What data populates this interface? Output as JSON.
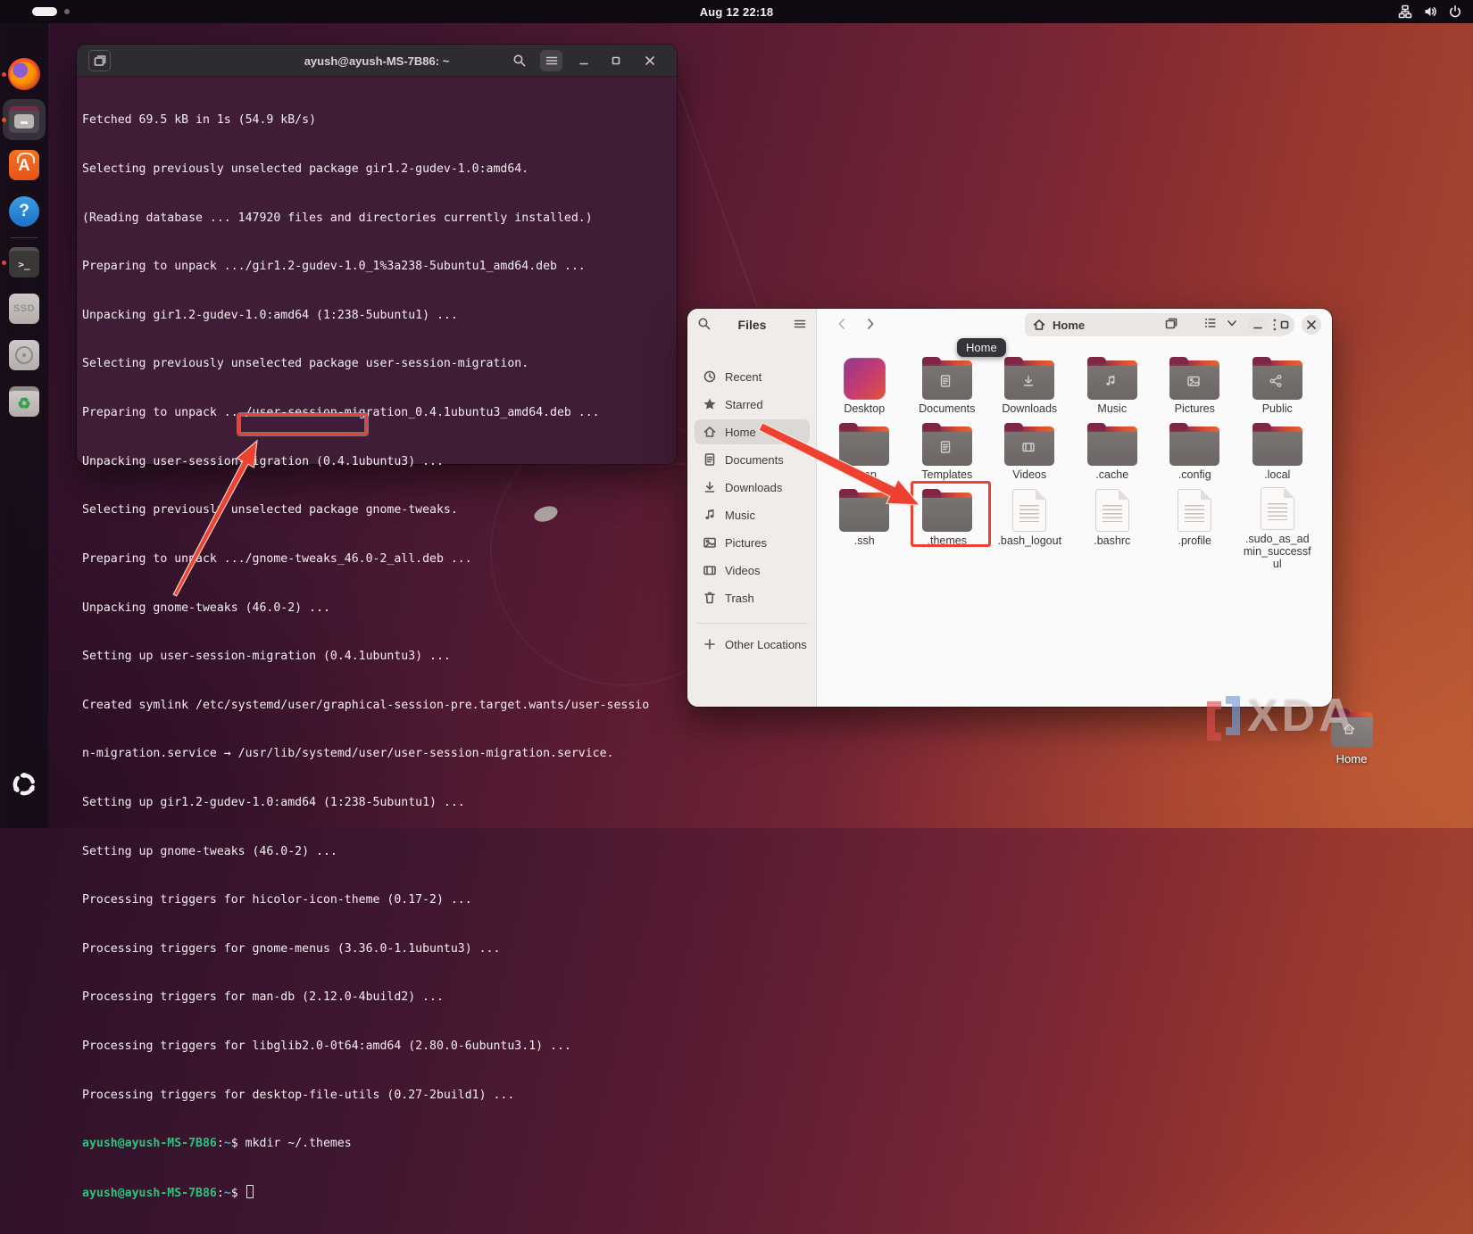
{
  "topbar": {
    "clock": "Aug 12 22:18",
    "tray_icons": [
      "network-icon",
      "volume-icon",
      "power-icon"
    ]
  },
  "dock": {
    "items": [
      "Firefox",
      "Files",
      "App Center",
      "Help",
      "Terminal",
      "SSD Drive",
      "Disk",
      "Trash",
      "Show Apps"
    ],
    "ssd_label": "SSD",
    "software_letter": "A",
    "help_mark": "?",
    "terminal_glyph": ">_"
  },
  "terminal": {
    "title": "ayush@ayush-MS-7B86: ~",
    "lines": [
      "Fetched 69.5 kB in 1s (54.9 kB/s)",
      "Selecting previously unselected package gir1.2-gudev-1.0:amd64.",
      "(Reading database ... 147920 files and directories currently installed.)",
      "Preparing to unpack .../gir1.2-gudev-1.0_1%3a238-5ubuntu1_amd64.deb ...",
      "Unpacking gir1.2-gudev-1.0:amd64 (1:238-5ubuntu1) ...",
      "Selecting previously unselected package user-session-migration.",
      "Preparing to unpack .../user-session-migration_0.4.1ubuntu3_amd64.deb ...",
      "Unpacking user-session-migration (0.4.1ubuntu3) ...",
      "Selecting previously unselected package gnome-tweaks.",
      "Preparing to unpack .../gnome-tweaks_46.0-2_all.deb ...",
      "Unpacking gnome-tweaks (46.0-2) ...",
      "Setting up user-session-migration (0.4.1ubuntu3) ...",
      "Created symlink /etc/systemd/user/graphical-session-pre.target.wants/user-sessio",
      "n-migration.service → /usr/lib/systemd/user/user-session-migration.service.",
      "Setting up gir1.2-gudev-1.0:amd64 (1:238-5ubuntu1) ...",
      "Setting up gnome-tweaks (46.0-2) ...",
      "Processing triggers for hicolor-icon-theme (0.17-2) ...",
      "Processing triggers for gnome-menus (3.36.0-1.1ubuntu3) ...",
      "Processing triggers for man-db (2.12.0-4build2) ...",
      "Processing triggers for libglib2.0-0t64:amd64 (2.80.0-6ubuntu3.1) ...",
      "Processing triggers for desktop-file-utils (0.27-2build1) ..."
    ],
    "prompt": {
      "user": "ayush@ayush-MS-7B86",
      "colon": ":",
      "path": "~",
      "dollar": "$ ",
      "command": "mkdir ~/.themes"
    }
  },
  "files": {
    "app_title": "Files",
    "location": "Home",
    "tooltip": "Home",
    "sidebar": [
      {
        "label": "Recent"
      },
      {
        "label": "Starred"
      },
      {
        "label": "Home"
      },
      {
        "label": "Documents"
      },
      {
        "label": "Downloads"
      },
      {
        "label": "Music"
      },
      {
        "label": "Pictures"
      },
      {
        "label": "Videos"
      },
      {
        "label": "Trash"
      }
    ],
    "other_locations_label": "Other Locations",
    "items": [
      {
        "label": "Desktop"
      },
      {
        "label": "Documents"
      },
      {
        "label": "Downloads"
      },
      {
        "label": "Music"
      },
      {
        "label": "Pictures"
      },
      {
        "label": "Public"
      },
      {
        "label": "snap"
      },
      {
        "label": "Templates"
      },
      {
        "label": "Videos"
      },
      {
        "label": ".cache"
      },
      {
        "label": ".config"
      },
      {
        "label": ".local"
      },
      {
        "label": ".ssh"
      },
      {
        "label": ".themes"
      },
      {
        "label": ".bash_logout"
      },
      {
        "label": ".bashrc"
      },
      {
        "label": ".profile"
      },
      {
        "label": ".sudo_as_admin_successful"
      }
    ]
  },
  "desktop_icon": {
    "label": "Home"
  },
  "watermark": {
    "text": "XDA"
  },
  "colors": {
    "annotation_red": "#ef4130",
    "terminal_bg": "#401d36",
    "prompt_green": "#2ec27e",
    "path_blue": "#51a1e0"
  }
}
